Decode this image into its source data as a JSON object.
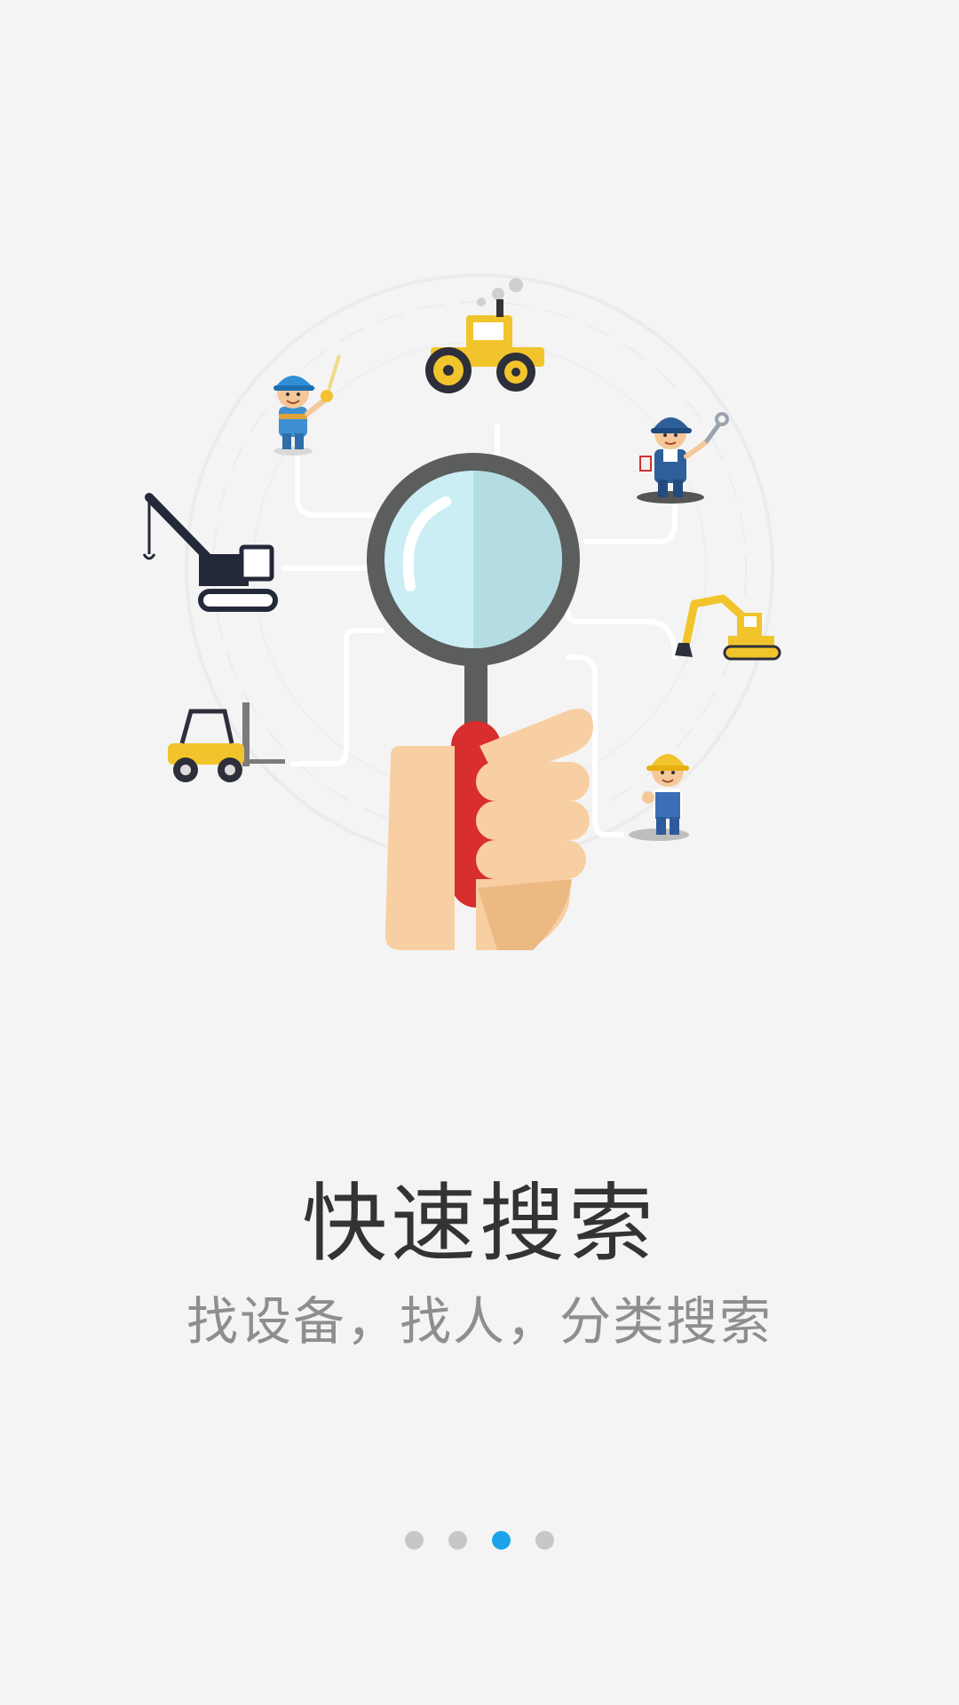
{
  "onboarding": {
    "title": "快速搜索",
    "subtitle": "找设备，找人，分类搜索",
    "page_indicator": {
      "count": 4,
      "active_index": 2,
      "active_color": "#1aa3e8",
      "inactive_color": "#c7c7c7"
    },
    "illustration": {
      "center": "magnifying-glass-hand",
      "items": [
        "worker-with-tape-measure",
        "road-roller",
        "worker-with-wrench",
        "crawler-crane",
        "excavator",
        "forklift",
        "worker-with-hardhat-thumbs-up"
      ]
    }
  }
}
